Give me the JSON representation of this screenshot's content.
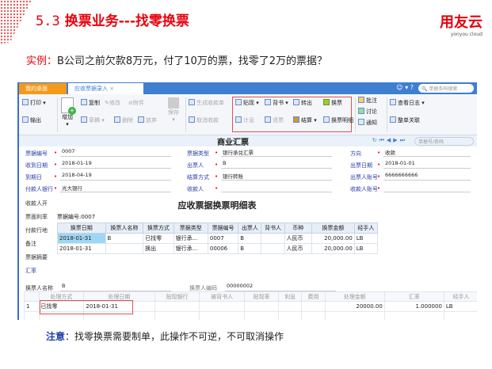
{
  "slide": {
    "number": "5.3",
    "title": "换票业务---找零换票",
    "logo_cn": "用友云",
    "logo_en": "yonyou cloud",
    "example_label": "实例：",
    "example_text": "B公司之前欠款8万元，付了10万的票，找零了2万的票据？",
    "note_label": "注意",
    "note_text": "：找零换票需要制单，此操作不可逆，不可取消操作"
  },
  "app": {
    "tabs": [
      "我的桌面",
      "应收票据录入"
    ],
    "tab_close": "×",
    "search_placeholder": "单据条码搜索",
    "toolbar": {
      "print": "打印",
      "export": "输出",
      "add": "增加",
      "copy": "复制",
      "edit": "修改",
      "attach": "附件",
      "draft": "草稿",
      "delete": "删除",
      "abandon": "放弃",
      "save": "保存",
      "gen_receipt": "生成收款单",
      "cancel_receipt": "取消收款",
      "discount": "贴现",
      "endorse": "背书",
      "transfer_out": "转出",
      "exchange": "换票",
      "interest": "计息",
      "return": "退票",
      "settle": "结算",
      "exchange_detail": "换票明细",
      "annotate": "批注",
      "discuss": "讨论",
      "notify": "通知",
      "view_log": "查看日志",
      "doc_link": "整单关联"
    },
    "doc_title": "商业汇票",
    "nav_search_placeholder": "单据号/条码",
    "form": [
      {
        "label": "票据编号",
        "value": "0007"
      },
      {
        "label": "票据类型",
        "value": "银行承兑汇票"
      },
      {
        "label": "方向",
        "value": "收款"
      },
      {
        "label": "收到日期",
        "value": "2018-01-19"
      },
      {
        "label": "出票人",
        "value": "B"
      },
      {
        "label": "出票日期",
        "value": "2018-01-01"
      },
      {
        "label": "到期日",
        "value": "2018-04-19"
      },
      {
        "label": "结算方式",
        "value": "银行转账"
      },
      {
        "label": "出票人账号",
        "value": "6666666666"
      },
      {
        "label": "付款人银行",
        "value": "光大银行"
      },
      {
        "label": "收款人",
        "value": ""
      },
      {
        "label": "收款人账号",
        "value": ""
      }
    ],
    "left_labels": [
      "收款人开",
      "票面利率",
      "付款行地",
      "备注",
      "票据摘要",
      "汇率"
    ],
    "exchanger_name_label": "换票人名称",
    "exchanger_name": "B",
    "exchanger_code_label": "换票人编码",
    "exchanger_code": "00000002",
    "popup": {
      "title": "应收票据换票明细表",
      "bill_no": "票据编号:0007",
      "headers": [
        "换票日期",
        "换票人名称",
        "换票方式",
        "票据类型",
        "票据编号",
        "出票人",
        "背书人",
        "币种",
        "换票金额",
        "经手人"
      ],
      "rows": [
        [
          "2018-01-31",
          "B",
          "已找零",
          "银行承...",
          "0007",
          "B",
          "",
          "人民币",
          "20,000.00",
          "LB"
        ],
        [
          "2018-01-31",
          "",
          "换出",
          "银行承...",
          "00006",
          "B",
          "",
          "人民币",
          "20,000.00",
          "LB"
        ]
      ]
    },
    "grid": {
      "headers": [
        "",
        "处理方式",
        "处理日期",
        "贴现银行",
        "被背书人",
        "贴现率",
        "利息",
        "费用",
        "处理金额",
        "汇率",
        "经手人"
      ],
      "rows": [
        [
          "1",
          "已找零",
          "2018-01-31",
          "",
          "",
          "",
          "",
          "",
          "20000.00",
          "1.000000",
          "LB"
        ]
      ]
    }
  }
}
